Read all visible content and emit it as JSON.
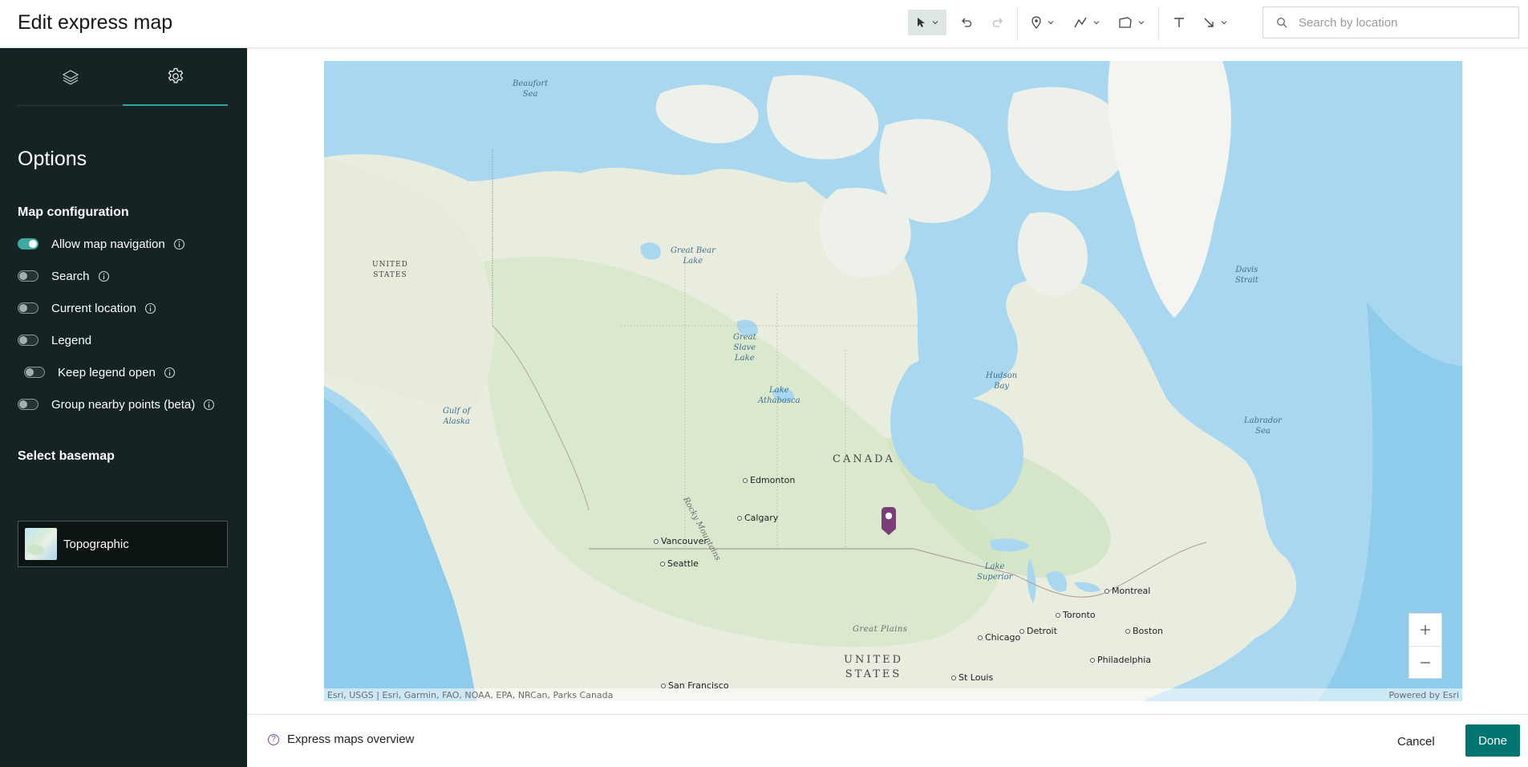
{
  "header": {
    "title": "Edit express map",
    "search": {
      "placeholder": "Search by location",
      "value": ""
    },
    "tools": [
      {
        "name": "select-tool",
        "icon": "pointer-icon",
        "active": true
      },
      {
        "name": "undo",
        "icon": "undo-icon"
      },
      {
        "name": "redo",
        "icon": "redo-icon",
        "disabled": true
      },
      {
        "name": "pin-tool",
        "icon": "map-pin-icon"
      },
      {
        "name": "line-tool",
        "icon": "polyline-icon"
      },
      {
        "name": "area-tool",
        "icon": "polygon-icon"
      },
      {
        "name": "text-tool",
        "icon": "text-icon"
      },
      {
        "name": "arrow-tool",
        "icon": "arrow-icon"
      }
    ]
  },
  "sidebar": {
    "tabs": [
      {
        "icon": "layers-icon",
        "selected": false
      },
      {
        "icon": "gear-icon",
        "selected": true
      }
    ],
    "heading": "Options",
    "map_configuration": {
      "title": "Map configuration",
      "options": [
        {
          "label": "Allow map navigation",
          "enabled": true
        },
        {
          "label": "Search",
          "enabled": false
        },
        {
          "label": "Current location",
          "enabled": false
        },
        {
          "label": "Legend",
          "enabled": false
        },
        {
          "label": "Keep legend open",
          "enabled": false
        },
        {
          "label": "Group nearby points (beta)",
          "enabled": false
        }
      ]
    },
    "basemap": {
      "title": "Select basemap",
      "selected": "Topographic"
    }
  },
  "map": {
    "water_labels": {
      "beaufort": "Beaufort\nSea",
      "great_bear": "Great Bear\nLake",
      "great_slave": "Great\nSlave\nLake",
      "athabasca": "Lake\nAthabasca",
      "hudson": "Hudson\nBay",
      "davis": "Davis\nStrait",
      "labrador": "Labrador\nSea",
      "alaska_gulf": "Gulf of\nAlaska",
      "superior": "Lake\nSuperior"
    },
    "land_labels": {
      "canada": "CANADA",
      "us_north": "UNITED\nSTATES",
      "us_south": "UNITED\nSTATES",
      "great_plains": "Great Plains",
      "rocky": "Rocky Mountains"
    },
    "cities": {
      "edmonton": "Edmonton",
      "calgary": "Calgary",
      "vancouver": "Vancouver",
      "seattle": "Seattle",
      "montreal": "Montreal",
      "toronto": "Toronto",
      "boston": "Boston",
      "detroit": "Detroit",
      "chicago": "Chicago",
      "philadelphia": "Philadelphia",
      "stlouis": "St Louis",
      "sanfrancisco": "San Francisco"
    },
    "attribution": "Esri, USGS | Esri, Garmin, FAO, NOAA, EPA, NRCan, Parks Canada",
    "powered_by": "Powered by Esri",
    "zoom_in": "+",
    "zoom_out": "—",
    "pin_color": "#7a3d7a"
  },
  "footer": {
    "help_link": "Express maps overview",
    "cancel": "Cancel",
    "done": "Done"
  },
  "colors": {
    "sidebar_bg": "#162324",
    "accent": "#00756f",
    "toggle_on": "#3fa8a1",
    "water": "#a9d7ef",
    "land": "#eef0e8"
  }
}
